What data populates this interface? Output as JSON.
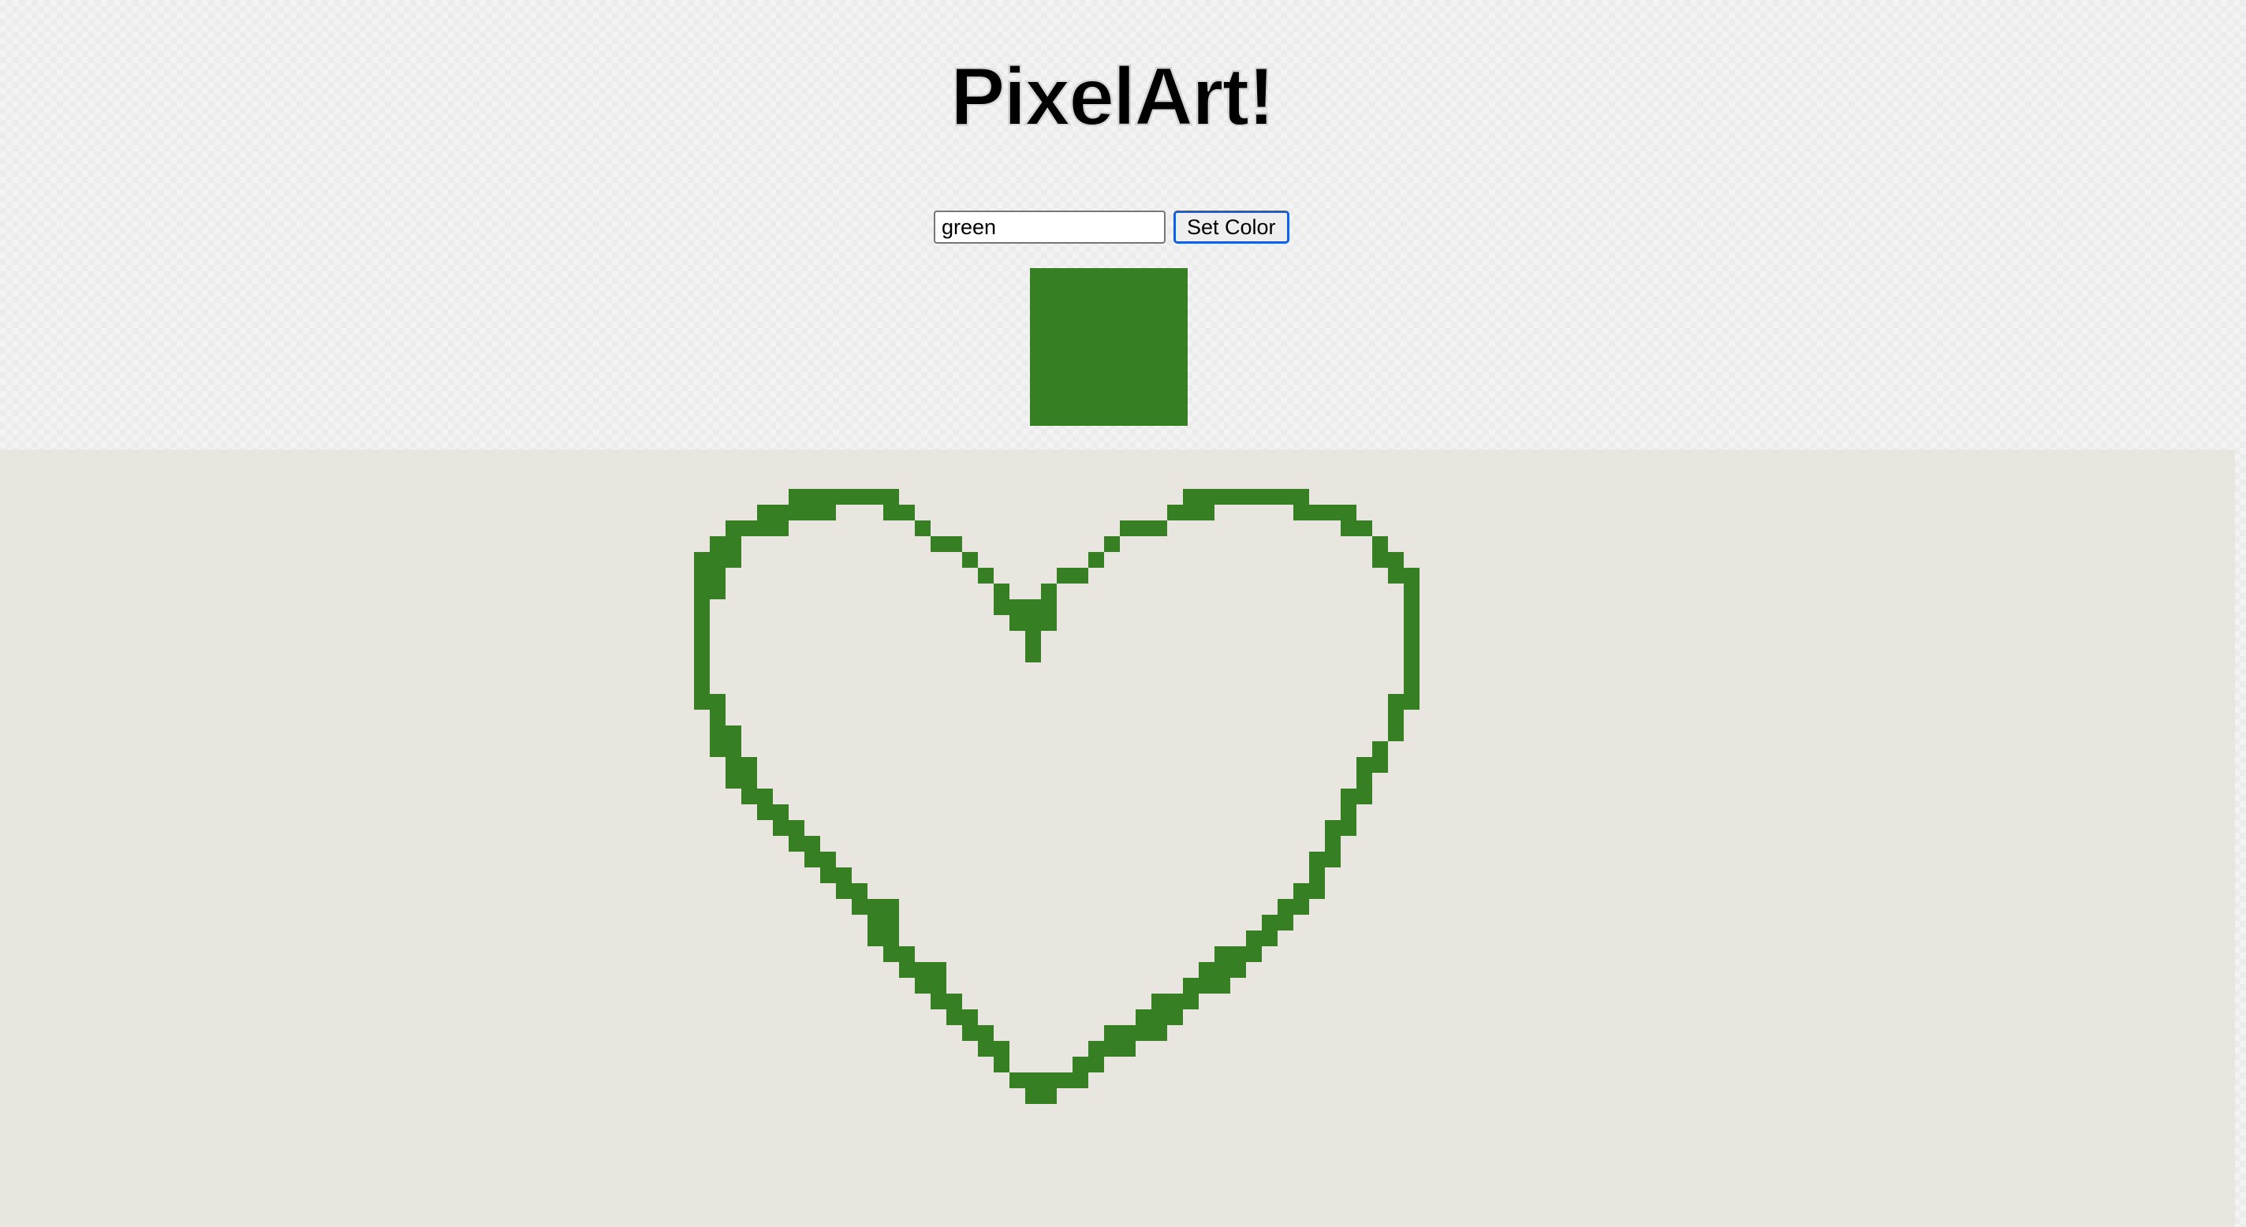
{
  "header": {
    "title": "PixelArt!"
  },
  "controls": {
    "color_value": "green",
    "set_color_label": "Set Color"
  },
  "colors": {
    "selected": "#367f22",
    "canvas_background": "#e8e6de",
    "page_background": "#f3f3f3"
  },
  "canvas": {
    "cell_units": 20,
    "painted_rows": [
      {
        "y": 31,
        "ranges": [
          [
            50,
            56
          ],
          [
            75,
            82
          ]
        ]
      },
      {
        "y": 32,
        "ranges": [
          [
            48,
            52
          ],
          [
            56,
            57
          ],
          [
            74,
            76
          ],
          [
            82,
            85
          ]
        ]
      },
      {
        "y": 33,
        "ranges": [
          [
            46,
            49
          ],
          [
            58,
            58
          ],
          [
            71,
            73
          ],
          [
            85,
            86
          ]
        ]
      },
      {
        "y": 34,
        "ranges": [
          [
            45,
            46
          ],
          [
            59,
            60
          ],
          [
            70,
            70
          ],
          [
            87,
            87
          ]
        ]
      },
      {
        "y": 35,
        "ranges": [
          [
            44,
            46
          ],
          [
            61,
            61
          ],
          [
            69,
            69
          ],
          [
            87,
            88
          ]
        ]
      },
      {
        "y": 36,
        "ranges": [
          [
            44,
            45
          ],
          [
            62,
            62
          ],
          [
            67,
            68
          ],
          [
            88,
            89
          ]
        ]
      },
      {
        "y": 37,
        "ranges": [
          [
            44,
            45
          ],
          [
            63,
            63
          ],
          [
            66,
            66
          ],
          [
            89,
            89
          ]
        ]
      },
      {
        "y": 38,
        "ranges": [
          [
            44,
            44
          ],
          [
            63,
            66
          ],
          [
            89,
            89
          ]
        ]
      },
      {
        "y": 39,
        "ranges": [
          [
            44,
            44
          ],
          [
            64,
            66
          ],
          [
            89,
            89
          ]
        ]
      },
      {
        "y": 40,
        "ranges": [
          [
            44,
            44
          ],
          [
            65,
            65
          ],
          [
            89,
            89
          ]
        ]
      },
      {
        "y": 41,
        "ranges": [
          [
            44,
            44
          ],
          [
            65,
            65
          ],
          [
            89,
            89
          ]
        ]
      },
      {
        "y": 42,
        "ranges": [
          [
            44,
            44
          ],
          [
            89,
            89
          ]
        ]
      },
      {
        "y": 43,
        "ranges": [
          [
            44,
            44
          ],
          [
            89,
            89
          ]
        ]
      },
      {
        "y": 44,
        "ranges": [
          [
            44,
            45
          ],
          [
            88,
            89
          ]
        ]
      },
      {
        "y": 45,
        "ranges": [
          [
            45,
            45
          ],
          [
            88,
            88
          ]
        ]
      },
      {
        "y": 46,
        "ranges": [
          [
            45,
            46
          ],
          [
            88,
            88
          ]
        ]
      },
      {
        "y": 47,
        "ranges": [
          [
            45,
            46
          ],
          [
            87,
            87
          ]
        ]
      },
      {
        "y": 48,
        "ranges": [
          [
            46,
            47
          ],
          [
            86,
            87
          ]
        ]
      },
      {
        "y": 49,
        "ranges": [
          [
            46,
            47
          ],
          [
            86,
            86
          ]
        ]
      },
      {
        "y": 50,
        "ranges": [
          [
            47,
            48
          ],
          [
            85,
            86
          ]
        ]
      },
      {
        "y": 51,
        "ranges": [
          [
            48,
            49
          ],
          [
            85,
            85
          ]
        ]
      },
      {
        "y": 52,
        "ranges": [
          [
            49,
            50
          ],
          [
            84,
            85
          ]
        ]
      },
      {
        "y": 53,
        "ranges": [
          [
            50,
            51
          ],
          [
            84,
            84
          ]
        ]
      },
      {
        "y": 54,
        "ranges": [
          [
            51,
            52
          ],
          [
            83,
            84
          ]
        ]
      },
      {
        "y": 55,
        "ranges": [
          [
            52,
            53
          ],
          [
            83,
            83
          ]
        ]
      },
      {
        "y": 56,
        "ranges": [
          [
            53,
            54
          ],
          [
            82,
            83
          ]
        ]
      },
      {
        "y": 57,
        "ranges": [
          [
            54,
            56
          ],
          [
            81,
            82
          ]
        ]
      },
      {
        "y": 58,
        "ranges": [
          [
            55,
            56
          ],
          [
            80,
            81
          ]
        ]
      },
      {
        "y": 59,
        "ranges": [
          [
            55,
            56
          ],
          [
            79,
            80
          ]
        ]
      },
      {
        "y": 60,
        "ranges": [
          [
            56,
            57
          ],
          [
            77,
            79
          ]
        ]
      },
      {
        "y": 61,
        "ranges": [
          [
            57,
            59
          ],
          [
            76,
            78
          ]
        ]
      },
      {
        "y": 62,
        "ranges": [
          [
            58,
            59
          ],
          [
            75,
            77
          ]
        ]
      },
      {
        "y": 63,
        "ranges": [
          [
            59,
            60
          ],
          [
            73,
            75
          ]
        ]
      },
      {
        "y": 64,
        "ranges": [
          [
            60,
            61
          ],
          [
            72,
            74
          ]
        ]
      },
      {
        "y": 65,
        "ranges": [
          [
            61,
            62
          ],
          [
            70,
            73
          ]
        ]
      },
      {
        "y": 66,
        "ranges": [
          [
            62,
            63
          ],
          [
            69,
            71
          ]
        ]
      },
      {
        "y": 67,
        "ranges": [
          [
            63,
            63
          ],
          [
            68,
            69
          ]
        ]
      },
      {
        "y": 68,
        "ranges": [
          [
            64,
            66
          ],
          [
            67,
            68
          ]
        ]
      },
      {
        "y": 69,
        "ranges": [
          [
            65,
            66
          ]
        ]
      }
    ]
  }
}
